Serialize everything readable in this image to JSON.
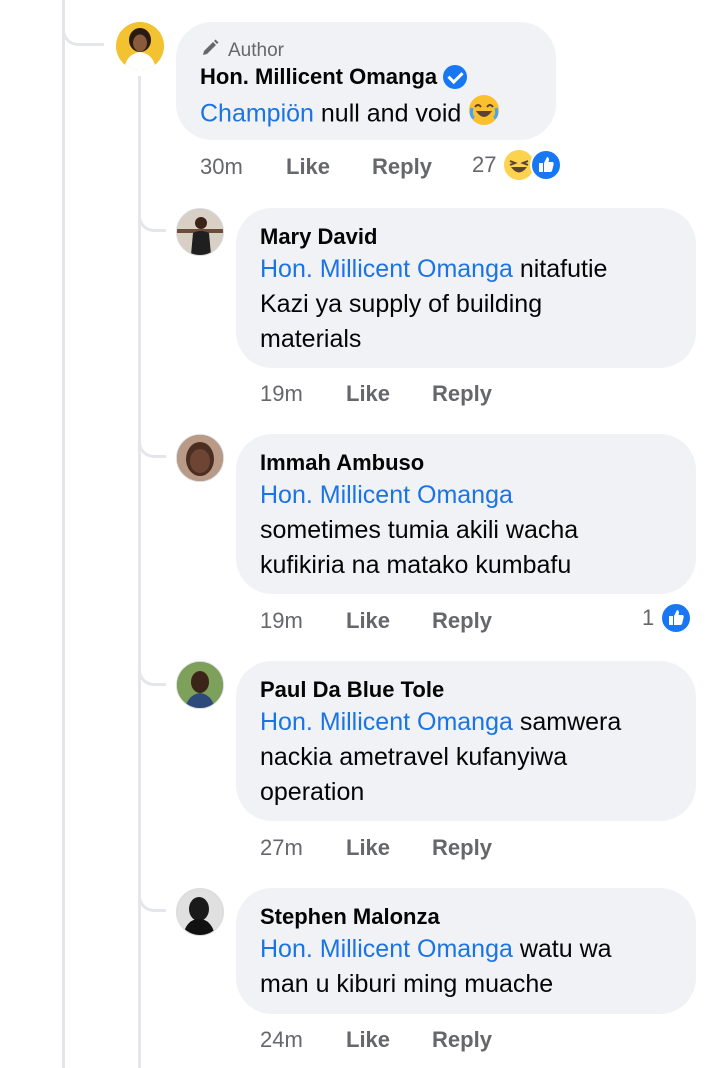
{
  "author_comment": {
    "badge": "Author",
    "name": "Hon. Millicent Omanga",
    "mention": "Champiön",
    "text": " null and void",
    "time": "30m",
    "like": "Like",
    "reply": "Reply",
    "reaction_count": "27",
    "reaction_icons": [
      "haha-icon",
      "like-icon"
    ]
  },
  "replies": [
    {
      "name": "Mary David",
      "mention": "Hon. Millicent Omanga",
      "line1_rest": " nitafutie",
      "line2": "Kazi ya supply of building",
      "line3": "materials",
      "time": "19m",
      "like": "Like",
      "reply": "Reply"
    },
    {
      "name": "Immah Ambuso",
      "mention": "Hon. Millicent Omanga",
      "line1_rest": "",
      "line2": "sometimes tumia akili wacha",
      "line3": "kufikiria na matako kumbafu",
      "time": "19m",
      "like": "Like",
      "reply": "Reply",
      "reaction_count": "1"
    },
    {
      "name": "Paul Da Blue Tole",
      "mention": "Hon. Millicent Omanga",
      "line1_rest": " samwera",
      "line2": "nackia ametravel kufanyiwa",
      "line3": "operation",
      "time": "27m",
      "like": "Like",
      "reply": "Reply"
    },
    {
      "name": "Stephen Malonza",
      "mention": "Hon. Millicent Omanga",
      "line1_rest": " watu wa",
      "line2": "man u kiburi ming muache",
      "time": "24m",
      "like": "Like",
      "reply": "Reply"
    }
  ],
  "colors": {
    "bubble": "#f0f2f5",
    "mention": "#1b74e4",
    "meta": "#65676b",
    "thread": "#e4e6eb",
    "like_blue": "#1877f2"
  }
}
